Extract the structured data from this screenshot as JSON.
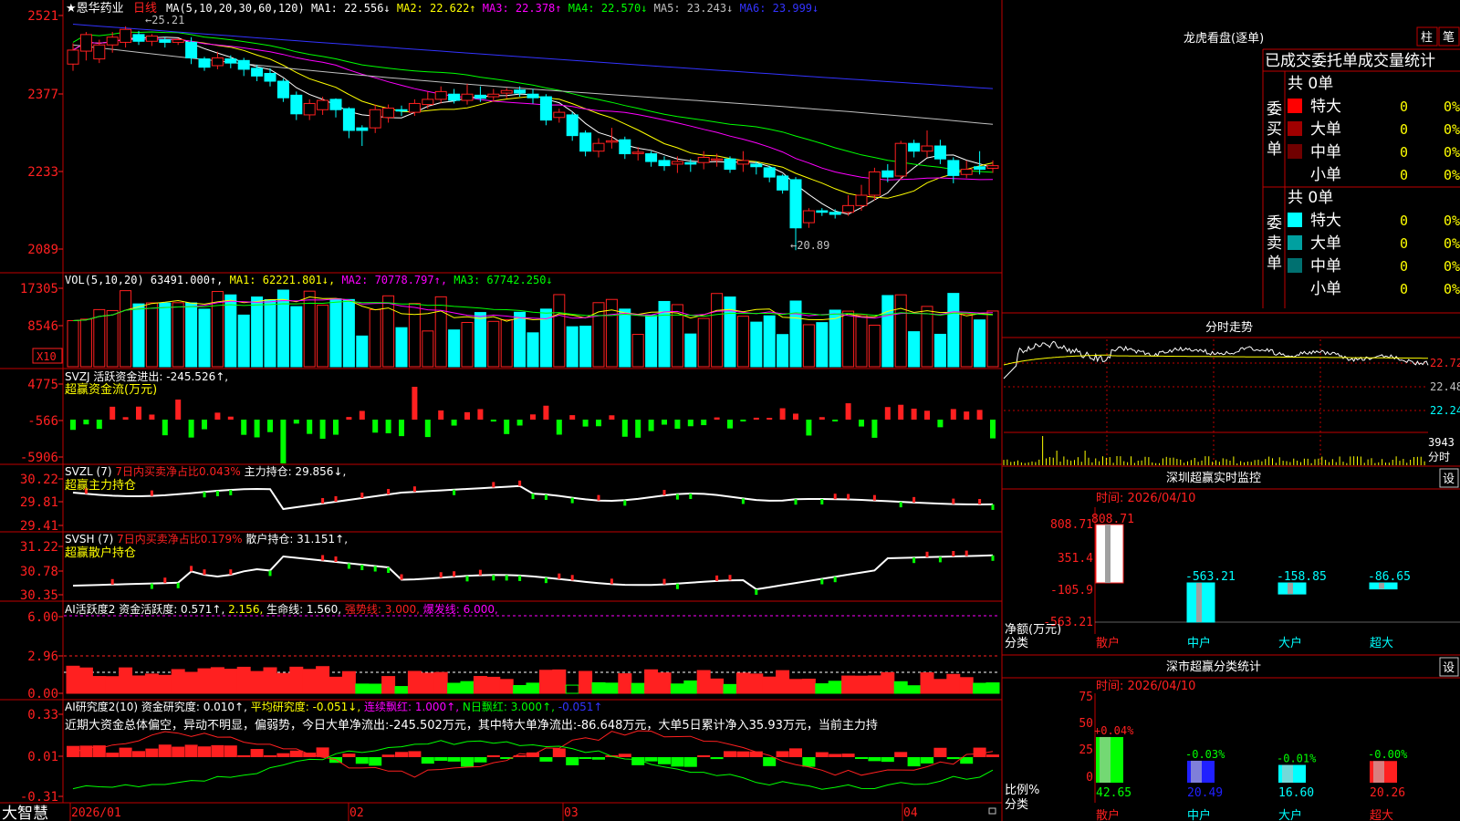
{
  "app": {
    "brand": "大智慧",
    "stock_title": "★恩华药业",
    "period": "日线"
  },
  "colors": {
    "up": "#ff2020",
    "down": "#00ffff",
    "grid": "#c00000",
    "bg": "#000000",
    "ma1": "#ffffff",
    "ma2": "#ffff00",
    "ma3": "#ff00ff",
    "ma4": "#00ff00",
    "ma5": "#c0c0c0",
    "ma6": "#3333ff"
  },
  "main_chart": {
    "legend": [
      {
        "text": "MA(5,10,20,30,60,120)",
        "color": "#ffffff"
      },
      {
        "text": "MA1: 22.556↓",
        "color": "#ffffff"
      },
      {
        "text": "MA2: 22.622↑",
        "color": "#ffff00"
      },
      {
        "text": "MA3: 22.378↑",
        "color": "#ff00ff"
      },
      {
        "text": "MA4: 22.570↓",
        "color": "#00ff00"
      },
      {
        "text": "MA5: 23.243↓",
        "color": "#c0c0c0"
      },
      {
        "text": "MA6: 23.999↓",
        "color": "#3333ff"
      }
    ],
    "y_ticks": [
      "2521",
      "2377",
      "2233",
      "2089"
    ],
    "high_label": "←25.21",
    "low_label": "←20.89",
    "x_ticks": [
      "2026/01",
      "02",
      "03",
      "04"
    ]
  },
  "vol_panel": {
    "legend": [
      {
        "text": "VOL(5,10,20) 63491.000↑,",
        "color": "#ffffff"
      },
      {
        "text": "MA1: 62221.801↓,",
        "color": "#ffff00"
      },
      {
        "text": "MA2: 70778.797↑,",
        "color": "#ff00ff"
      },
      {
        "text": "MA3: 67742.250↓",
        "color": "#00ff00"
      }
    ],
    "y_ticks": [
      "17305",
      "8546"
    ],
    "unit": "X10"
  },
  "svzj_panel": {
    "legend": [
      {
        "text": "SVZJ 活跃资金进出: -245.526↑,",
        "color": "#ffffff"
      }
    ],
    "title": "超赢资金流(万元)",
    "y_ticks": [
      "4775",
      "-566",
      "-5906"
    ]
  },
  "svzl_panel": {
    "legend": [
      {
        "text": "SVZL (7) ",
        "color": "#ffffff"
      },
      {
        "text": "7日内买卖净占比0.043%",
        "color": "#ff2020"
      },
      {
        "text": " 主力持仓: 29.856↓,",
        "color": "#ffffff"
      }
    ],
    "title": "超赢主力持仓",
    "y_ticks": [
      "30.22",
      "29.81",
      "29.41"
    ]
  },
  "svsh_panel": {
    "legend": [
      {
        "text": "SVSH (7) ",
        "color": "#ffffff"
      },
      {
        "text": "7日内买卖净占比0.179%",
        "color": "#ff2020"
      },
      {
        "text": " 散户持仓: 31.151↑,",
        "color": "#ffffff"
      }
    ],
    "title": "超赢散户持仓",
    "y_ticks": [
      "31.22",
      "30.78",
      "30.35"
    ]
  },
  "ai_active_panel": {
    "legend": [
      {
        "text": "AI活跃度2 资金活跃度: 0.571↑,",
        "color": "#ffffff"
      },
      {
        "text": "2.156,",
        "color": "#ffff00"
      },
      {
        "text": " 生命线: 1.560,",
        "color": "#ffffff"
      },
      {
        "text": " 强势线: 3.000,",
        "color": "#ff2020"
      },
      {
        "text": " 爆发线: 6.000,",
        "color": "#ff00ff"
      }
    ],
    "y_ticks": [
      "6.00",
      "2.96",
      "0.00"
    ]
  },
  "ai_research_panel": {
    "legend": [
      {
        "text": "AI研究度2(10) 资金研究度: 0.010↑,",
        "color": "#ffffff"
      },
      {
        "text": " 平均研究度: -0.051↓,",
        "color": "#ffff00"
      },
      {
        "text": " 连续飘红: 1.000↑,",
        "color": "#ff00ff"
      },
      {
        "text": " N日飘红: 3.000↑,",
        "color": "#00ff00"
      },
      {
        "text": " -0.051↑",
        "color": "#3333ff"
      }
    ],
    "commentary": "近期大资金总体偏空，异动不明显，偏弱势，今日大单净流出:-245.502万元，其中特大单净流出:-86.648万元，大单5日累计净入35.93万元，当前主力持",
    "y_ticks": [
      "0.33",
      "0.01",
      "-0.31"
    ]
  },
  "right_panel": {
    "dragon": {
      "title": "龙虎看盘(逐单)",
      "btn_bar": "柱",
      "btn_pen": "笔",
      "tabs": [
        "已成交",
        "委托单",
        "成交量统计"
      ],
      "buy": {
        "side_label": "委买单",
        "total": "共 0单",
        "rows": [
          {
            "label": "特大",
            "count": "0",
            "pct": "0%",
            "color": "#ff0000"
          },
          {
            "label": "大单",
            "count": "0",
            "pct": "0%",
            "color": "#a00000"
          },
          {
            "label": "中单",
            "count": "0",
            "pct": "0%",
            "color": "#700000"
          },
          {
            "label": "小单",
            "count": "0",
            "pct": "0%",
            "color": "#000000"
          }
        ]
      },
      "sell": {
        "side_label": "委卖单",
        "total": "共 0单",
        "rows": [
          {
            "label": "特大",
            "count": "0",
            "pct": "0%",
            "color": "#00ffff"
          },
          {
            "label": "大单",
            "count": "0",
            "pct": "0%",
            "color": "#00a0a0"
          },
          {
            "label": "中单",
            "count": "0",
            "pct": "0%",
            "color": "#007070"
          },
          {
            "label": "小单",
            "count": "0",
            "pct": "0%",
            "color": "#000000"
          }
        ]
      }
    },
    "intraday": {
      "title": "分时走势",
      "y_ticks": [
        "22.72",
        "22.48",
        "22.24"
      ],
      "vol_tick": "3943",
      "vol_label": "分时"
    },
    "monitor": {
      "title": "深圳超赢实时监控",
      "set_btn": "设",
      "time": "时间: 2026/04/10",
      "y_ticks": [
        "808.71",
        "351.4",
        "-105.9",
        "-563.21"
      ],
      "unit_label": "净额(万元)",
      "class_label": "分类",
      "bars": [
        {
          "name": "散户",
          "value": 808.71,
          "label": "808.71",
          "color": "#ffffff",
          "name_color": "#ff2020"
        },
        {
          "name": "中户",
          "value": -563.21,
          "label": "-563.21",
          "color": "#00ffff",
          "name_color": "#00ffff"
        },
        {
          "name": "大户",
          "value": -158.85,
          "label": "-158.85",
          "color": "#00ffff",
          "name_color": "#00ffff"
        },
        {
          "name": "超大",
          "value": -86.65,
          "label": "-86.65",
          "color": "#00ffff",
          "name_color": "#00ffff"
        }
      ]
    },
    "classify": {
      "title": "深市超赢分类统计",
      "set_btn": "设",
      "time": "时间: 2026/04/10",
      "y_ticks": [
        "75",
        "50",
        "25",
        "0"
      ],
      "unit_label": "比例%",
      "class_label": "分类",
      "bars": [
        {
          "name": "散户",
          "value": 42.65,
          "label": "42.65",
          "delta": "+0.04%",
          "color": "#00ff00",
          "delta_color": "#ff2020",
          "name_color": "#ff2020"
        },
        {
          "name": "中户",
          "value": 20.49,
          "label": "20.49",
          "delta": "-0.03%",
          "color": "#2020ff",
          "delta_color": "#00ff00",
          "name_color": "#00ffff"
        },
        {
          "name": "大户",
          "value": 16.6,
          "label": "16.60",
          "delta": "-0.01%",
          "color": "#00ffff",
          "delta_color": "#00ff00",
          "name_color": "#00ffff"
        },
        {
          "name": "超大",
          "value": 20.26,
          "label": "20.26",
          "delta": "-0.00%",
          "color": "#ff2020",
          "delta_color": "#00ff00",
          "name_color": "#ff2020"
        }
      ]
    }
  },
  "chart_data": {
    "type": "candlestick",
    "title": "恩华药业 日线",
    "ylim": [
      20.5,
      25.5
    ],
    "candles": [
      [
        24.48,
        24.75,
        24.7,
        24.88,
        24.35
      ],
      [
        24.73,
        25.05,
        24.63,
        25.1,
        24.55
      ],
      [
        24.58,
        24.85,
        24.82,
        24.95,
        24.5
      ],
      [
        24.85,
        25.0,
        24.85,
        25.1,
        24.7
      ],
      [
        24.9,
        25.15,
        24.86,
        25.21,
        24.8
      ],
      [
        25.05,
        24.92,
        24.9,
        25.12,
        24.85
      ],
      [
        24.92,
        25.02,
        24.93,
        25.06,
        24.83
      ],
      [
        24.95,
        24.9,
        24.88,
        25.0,
        24.8
      ],
      [
        24.9,
        24.95,
        24.92,
        24.98,
        24.85
      ],
      [
        24.9,
        24.6,
        24.55,
        25.0,
        24.48
      ],
      [
        24.58,
        24.42,
        24.38,
        24.62,
        24.35
      ],
      [
        24.45,
        24.6,
        24.4,
        24.72,
        24.38
      ],
      [
        24.58,
        24.5,
        24.45,
        24.65,
        24.4
      ],
      [
        24.55,
        24.38,
        24.3,
        24.6,
        24.25
      ],
      [
        24.4,
        24.25,
        24.2,
        24.46,
        24.15
      ],
      [
        24.3,
        24.15,
        24.1,
        24.4,
        24.05
      ],
      [
        24.15,
        23.83,
        23.8,
        24.2,
        23.75
      ],
      [
        23.88,
        23.52,
        23.45,
        23.95,
        23.4
      ],
      [
        23.5,
        23.72,
        23.45,
        23.8,
        23.4
      ],
      [
        23.6,
        23.78,
        23.55,
        23.85,
        23.5
      ],
      [
        23.8,
        23.6,
        23.55,
        23.82,
        23.45
      ],
      [
        23.62,
        23.2,
        23.15,
        23.65,
        23.05
      ],
      [
        23.25,
        23.2,
        23.1,
        23.3,
        22.9
      ],
      [
        23.25,
        23.6,
        23.2,
        23.7,
        23.15
      ],
      [
        23.45,
        23.63,
        23.4,
        23.7,
        23.35
      ],
      [
        23.6,
        23.58,
        23.5,
        23.68,
        23.48
      ],
      [
        23.55,
        23.72,
        23.52,
        23.8,
        23.48
      ],
      [
        23.7,
        23.8,
        23.65,
        23.95,
        23.62
      ],
      [
        23.8,
        23.95,
        23.75,
        24.05,
        23.72
      ],
      [
        23.9,
        23.78,
        23.75,
        24.0,
        23.72
      ],
      [
        23.78,
        23.9,
        23.72,
        24.1,
        23.7
      ],
      [
        23.88,
        23.82,
        23.78,
        24.05,
        23.75
      ],
      [
        23.85,
        23.9,
        23.8,
        24.0,
        23.75
      ],
      [
        23.92,
        23.97,
        23.88,
        24.02,
        23.82
      ],
      [
        23.98,
        23.92,
        23.9,
        24.05,
        23.85
      ],
      [
        23.9,
        23.83,
        23.8,
        24.0,
        23.72
      ],
      [
        23.85,
        23.4,
        23.35,
        23.9,
        23.3
      ],
      [
        23.45,
        23.55,
        23.38,
        23.62,
        23.35
      ],
      [
        23.5,
        23.1,
        23.05,
        23.55,
        23.0
      ],
      [
        23.15,
        22.8,
        22.75,
        23.2,
        22.7
      ],
      [
        22.8,
        22.95,
        22.7,
        23.05,
        22.68
      ],
      [
        22.98,
        23.0,
        22.9,
        23.25,
        22.85
      ],
      [
        23.02,
        22.75,
        22.7,
        23.08,
        22.65
      ],
      [
        22.78,
        22.78,
        22.65,
        22.88,
        22.62
      ],
      [
        22.75,
        22.6,
        22.55,
        22.8,
        22.5
      ],
      [
        22.62,
        22.52,
        22.45,
        22.7,
        22.42
      ],
      [
        22.55,
        22.6,
        22.4,
        22.7,
        22.38
      ],
      [
        22.58,
        22.55,
        22.45,
        22.65,
        22.4
      ],
      [
        22.58,
        22.68,
        22.5,
        22.8,
        22.45
      ],
      [
        22.65,
        22.65,
        22.55,
        22.75,
        22.5
      ],
      [
        22.65,
        22.45,
        22.4,
        22.7,
        22.38
      ],
      [
        22.55,
        22.62,
        22.45,
        22.8,
        22.4
      ],
      [
        22.55,
        22.5,
        22.42,
        22.6,
        22.35
      ],
      [
        22.48,
        22.3,
        22.25,
        22.52,
        22.2
      ],
      [
        22.32,
        22.05,
        22.0,
        22.35,
        21.98
      ],
      [
        22.25,
        21.32,
        21.28,
        22.3,
        20.89
      ],
      [
        21.42,
        21.65,
        21.38,
        21.7,
        21.32
      ],
      [
        21.65,
        21.62,
        21.58,
        21.7,
        21.55
      ],
      [
        21.62,
        21.58,
        21.52,
        21.68,
        21.5
      ],
      [
        21.62,
        21.75,
        21.58,
        21.95,
        21.55
      ],
      [
        21.75,
        21.95,
        21.68,
        22.15,
        21.65
      ],
      [
        21.95,
        22.4,
        21.88,
        22.48,
        21.85
      ],
      [
        22.42,
        22.3,
        22.25,
        22.55,
        22.2
      ],
      [
        22.32,
        22.95,
        22.28,
        23.0,
        22.25
      ],
      [
        22.95,
        22.8,
        22.72,
        23.02,
        22.68
      ],
      [
        22.8,
        22.9,
        22.72,
        23.2,
        22.68
      ],
      [
        22.9,
        22.65,
        22.6,
        23.02,
        22.55
      ],
      [
        22.62,
        22.33,
        22.28,
        22.68,
        22.18
      ],
      [
        22.35,
        22.45,
        22.3,
        22.62,
        22.28
      ],
      [
        22.5,
        22.45,
        22.4,
        22.8,
        22.35
      ],
      [
        22.47,
        22.52,
        22.42,
        22.62,
        22.38
      ]
    ]
  }
}
